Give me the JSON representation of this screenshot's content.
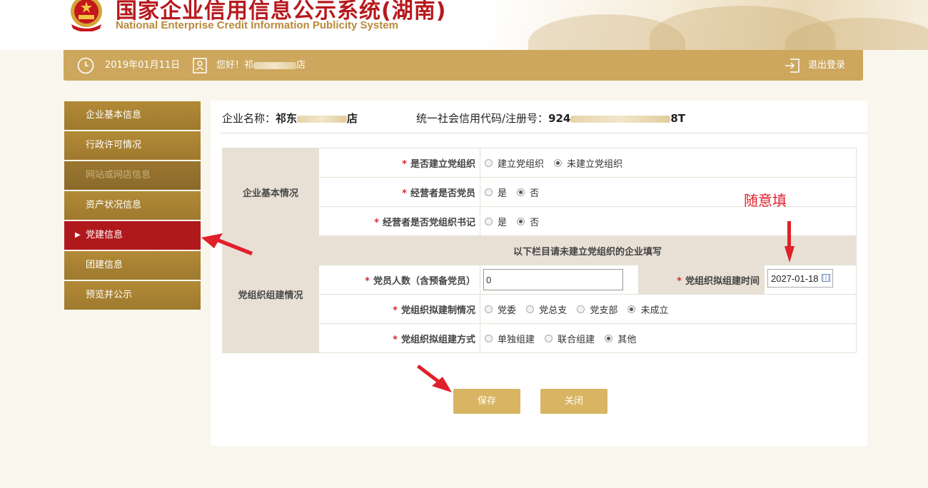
{
  "header": {
    "title_cn": "国家企业信用信息公示系统(湖南)",
    "title_en": "National Enterprise Credit Information Publicity System"
  },
  "topbar": {
    "date": "2019年01月11日",
    "greeting_prefix": "您好！祁",
    "greeting_suffix": "店",
    "logout": "退出登录"
  },
  "sidebar": {
    "items": [
      {
        "label": "企业基本信息"
      },
      {
        "label": "行政许可情况"
      },
      {
        "label": "网站或网店信息"
      },
      {
        "label": "资产状况信息"
      },
      {
        "label": "党建信息"
      },
      {
        "label": "团建信息"
      },
      {
        "label": "预览并公示"
      }
    ]
  },
  "company": {
    "name_label": "企业名称：",
    "name_prefix": "祁东",
    "name_suffix": "店",
    "code_label": "统一社会信用代码/注册号：",
    "code_prefix": "924",
    "code_suffix": "8T"
  },
  "form": {
    "group1": "企业基本情况",
    "group2": "党组织组建情况",
    "required_mark": "*",
    "q1": {
      "label": "是否建立党组织",
      "options": [
        "建立党组织",
        "未建立党组织"
      ],
      "selected": 1
    },
    "q2": {
      "label": "经营者是否党员",
      "options": [
        "是",
        "否"
      ],
      "selected": 1
    },
    "q3": {
      "label": "经营者是否党组织书记",
      "options": [
        "是",
        "否"
      ],
      "selected": 1
    },
    "subhead": "以下栏目请未建立党组织的企业填写",
    "q4": {
      "label": "党员人数（含预备党员）",
      "value": "0"
    },
    "q5": {
      "label": "党组织拟组建时间",
      "value": "2027-01-18"
    },
    "q6": {
      "label": "党组织拟建制情况",
      "options": [
        "党委",
        "党总支",
        "党支部",
        "未成立"
      ],
      "selected": 3
    },
    "q7": {
      "label": "党组织拟组建方式",
      "options": [
        "单独组建",
        "联合组建",
        "其他"
      ],
      "selected": 2
    }
  },
  "buttons": {
    "save": "保存",
    "close": "关闭"
  },
  "annotation": {
    "text": "随意填",
    "color": "#e0202a"
  },
  "colors": {
    "gold": "#cda75d",
    "sidebar": "#b28a37",
    "active": "#b0191c",
    "button": "#d8b563"
  }
}
